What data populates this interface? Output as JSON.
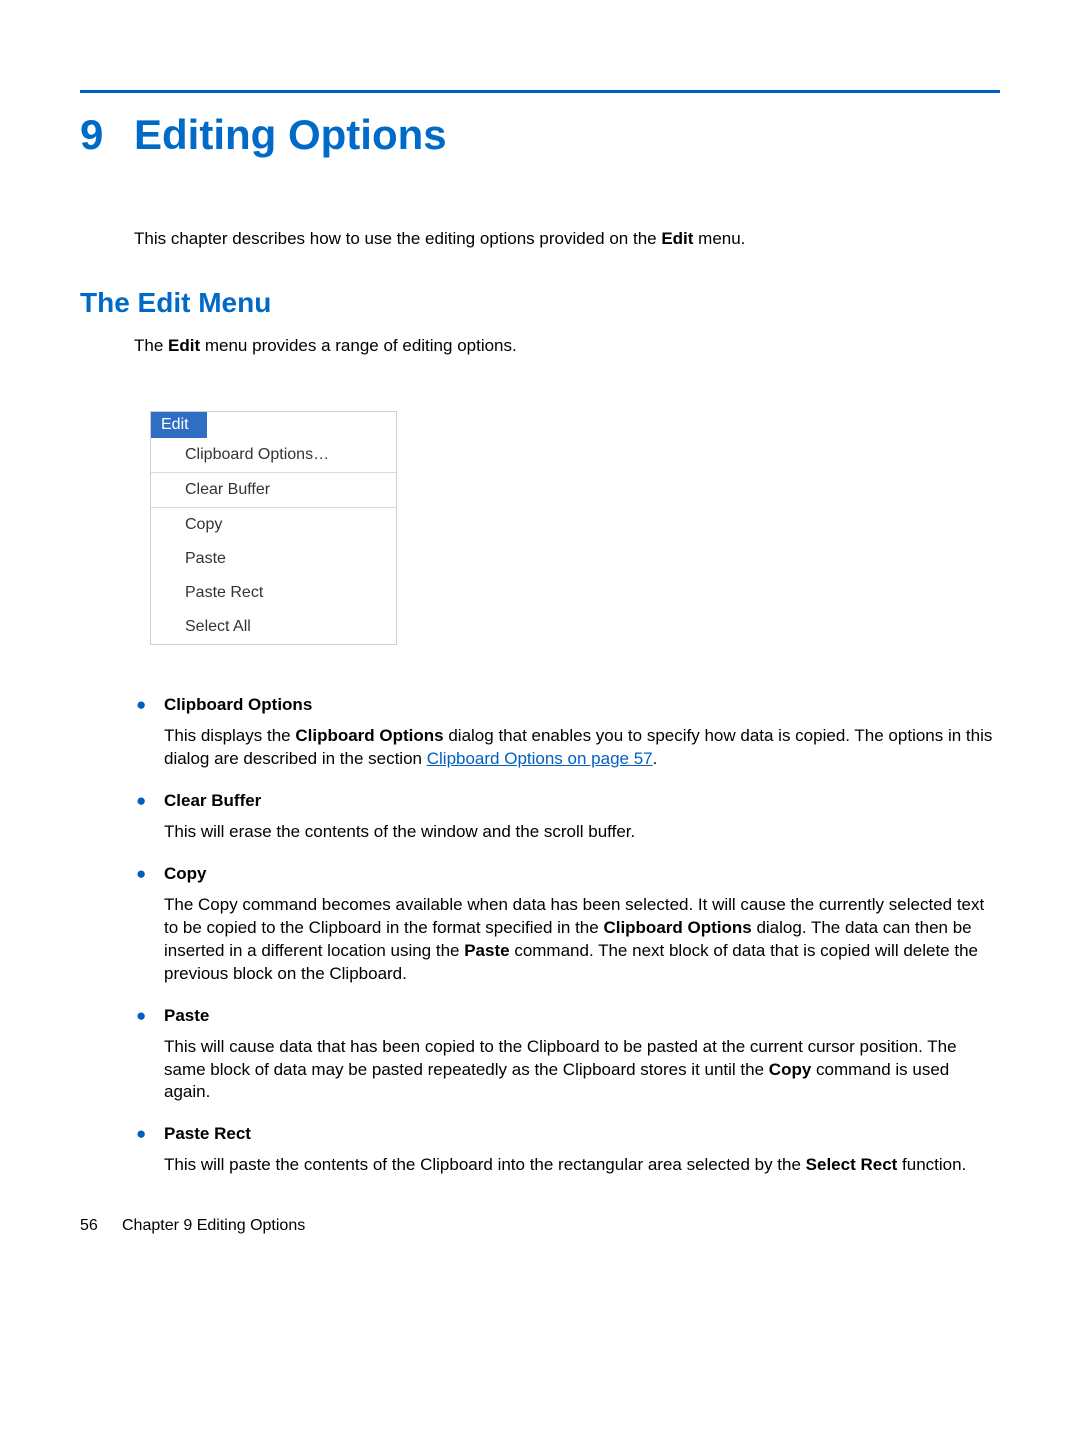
{
  "chapter": {
    "number": "9",
    "title": "Editing Options",
    "intro_before": "This chapter describes how to use the editing options provided on the ",
    "intro_bold": "Edit",
    "intro_after": " menu."
  },
  "section": {
    "title": "The Edit Menu",
    "text_before": "The ",
    "text_bold": "Edit",
    "text_after": " menu provides a range of editing options."
  },
  "menu": {
    "title": "Edit",
    "items": [
      "Clipboard Options…",
      "Clear Buffer",
      "Copy",
      "Paste",
      "Paste Rect",
      "Select All"
    ]
  },
  "bullets": {
    "clipboard": {
      "heading": "Clipboard Options",
      "t1": "This displays the ",
      "b1": "Clipboard Options",
      "t2": " dialog that enables you to specify how data is copied. The options in this dialog are described in the section ",
      "link": "Clipboard Options on page 57",
      "t3": "."
    },
    "clear": {
      "heading": "Clear Buffer",
      "text": "This will erase the contents of the window and the scroll buffer."
    },
    "copy": {
      "heading": "Copy",
      "t1": "The Copy command becomes available when data has been selected. It will cause the currently selected text to be copied to the Clipboard in the format specified in the ",
      "b1": "Clipboard Options",
      "t2": " dialog. The data can then be inserted in a different location using the ",
      "b2": "Paste",
      "t3": " command. The next block of data that is copied will delete the previous block on the Clipboard."
    },
    "paste": {
      "heading": "Paste",
      "t1": "This will cause data that has been copied to the Clipboard to be pasted at the current cursor position. The same block of data may be pasted repeatedly as the Clipboard stores it until the ",
      "b1": "Copy",
      "t2": " command is used again."
    },
    "pasterect": {
      "heading": "Paste Rect",
      "t1": "This will paste the contents of the Clipboard into the rectangular area selected by the ",
      "b1": "Select Rect",
      "t2": " function."
    }
  },
  "footer": {
    "page": "56",
    "chapter_label": "Chapter 9   Editing Options"
  }
}
